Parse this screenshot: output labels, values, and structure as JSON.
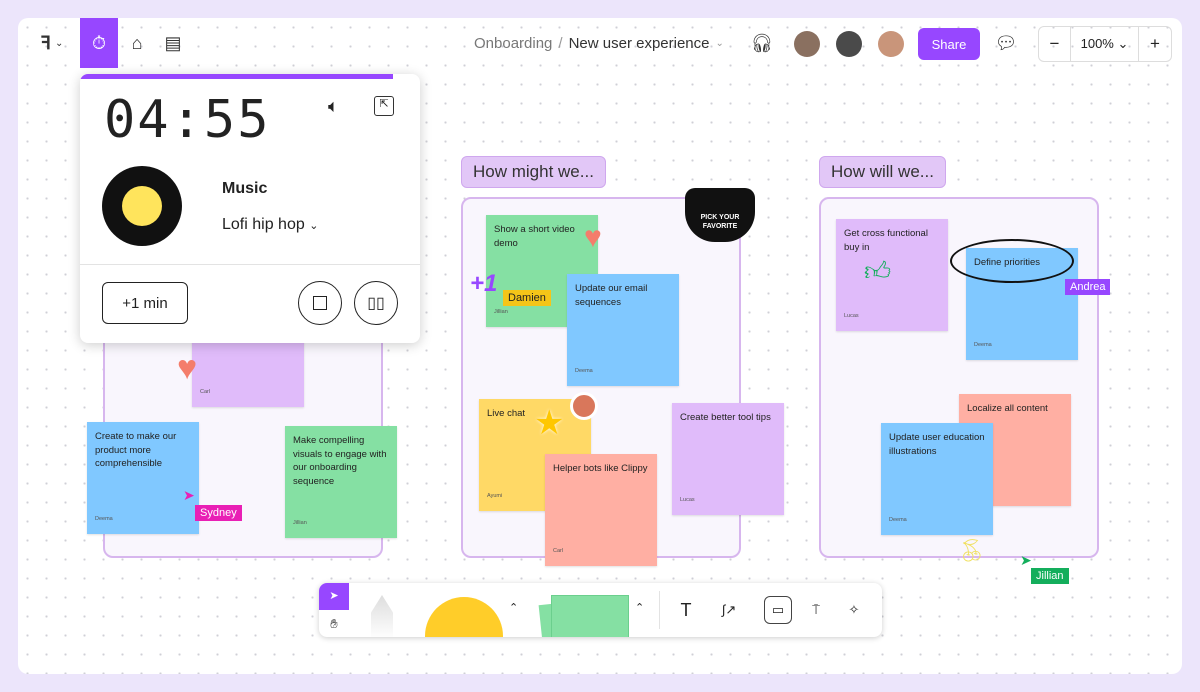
{
  "header": {
    "breadcrumb_parent": "Onboarding",
    "breadcrumb_sep": "/",
    "file_name": "New user experience",
    "share_label": "Share",
    "zoom": "100%",
    "zoom_minus": "−",
    "zoom_plus": "+"
  },
  "timer": {
    "time": "04:55",
    "music_label": "Music",
    "track": "Lofi hip hop",
    "add_min_label": "+1 min",
    "progress": 0.92
  },
  "sections": [
    {
      "title": "How might we..."
    },
    {
      "title": "How will we..."
    }
  ],
  "notes": [
    {
      "text": "",
      "author": "Carl"
    },
    {
      "text": "Create to make our product more comprehensible",
      "author": "Deema"
    },
    {
      "text": "Make compelling visuals to engage with our onboarding sequence",
      "author": "Jillian"
    },
    {
      "text": "Show a short video demo",
      "author": "Jillian"
    },
    {
      "text": "Update our email sequences",
      "author": "Deema"
    },
    {
      "text": "Live chat",
      "author": "Ayumi"
    },
    {
      "text": "Helper bots like Clippy",
      "author": "Carl"
    },
    {
      "text": "Create better tool tips",
      "author": "Lucas"
    },
    {
      "text": "Get cross functional buy in",
      "author": "Lucas"
    },
    {
      "text": "Define priorities",
      "author": "Deema"
    },
    {
      "text": "Localize all content",
      "author": ""
    },
    {
      "text": "Update user education illustrations",
      "author": "Deema"
    }
  ],
  "cursors": [
    {
      "name": "Sydney",
      "color": "#e91fb5"
    },
    {
      "name": "Damien",
      "color": "#f5c518"
    },
    {
      "name": "Andrea",
      "color": "#9747ff"
    },
    {
      "name": "Jillian",
      "color": "#14ae5c"
    }
  ],
  "stickers": {
    "bowl_text": "PICK YOUR FAVORITE",
    "plus_one": "+1"
  },
  "colors": {
    "accent": "#9747ff"
  }
}
